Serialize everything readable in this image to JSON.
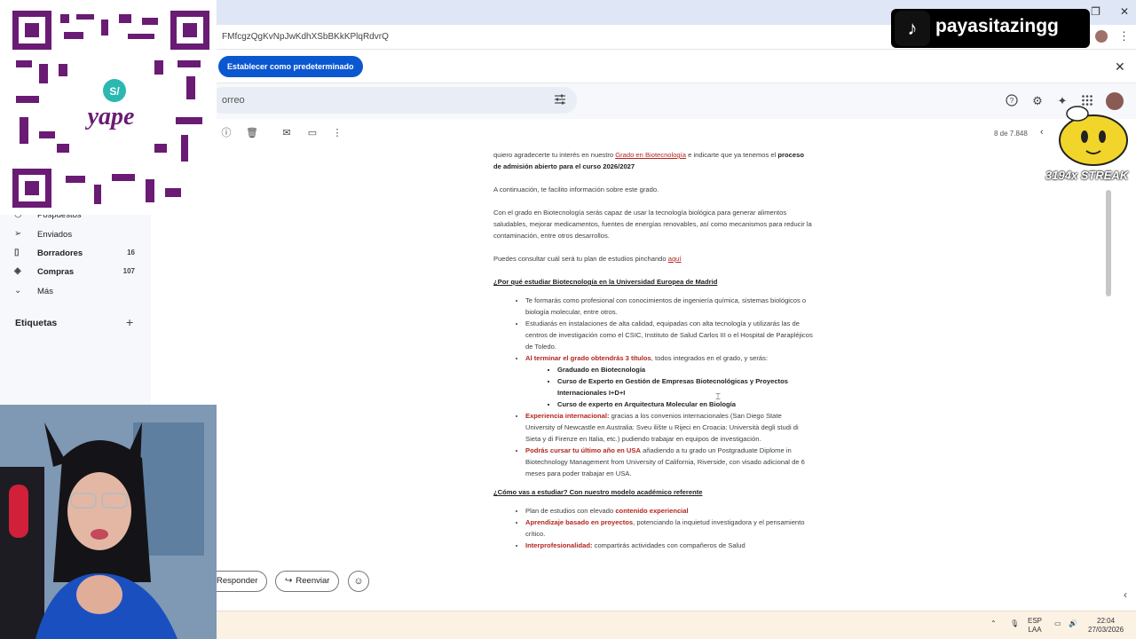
{
  "browser": {
    "url_fragment": "FMfcgzQgKvNpJwKdhXSbBKkKPlqRdvrQ",
    "set_default_button": "Establecer como predeterminado",
    "close_label": "✕",
    "menu_label": "⋮"
  },
  "gmail": {
    "search_placeholder": "orreo",
    "toolbar": {
      "pager": "8 de 7.848",
      "prev_label": "‹"
    },
    "sidebar": {
      "items": [
        {
          "label": "Pospuestos",
          "count": ""
        },
        {
          "label": "Enviados",
          "count": ""
        },
        {
          "label": "Borradores",
          "count": "16"
        },
        {
          "label": "Compras",
          "count": "107"
        },
        {
          "label": "Más",
          "count": ""
        }
      ],
      "labels_heading": "Etiquetas",
      "labels_add": "+"
    },
    "email": {
      "p1_a": "quiero agradecerte tu interés en nuestro ",
      "p1_link": "Grado en Biotecnología",
      "p1_b": " e indicarte que ya tenemos el ",
      "p1_bold": "proceso de admisión abierto para el curso 2026/2027",
      "p2": "A continuación, te facilito información sobre este grado.",
      "p3": "Con el grado en Biotecnología serás capaz de usar la tecnología biológica para generar alimentos saludables, mejorar medicamentos, fuentes de energías renovables, así como mecanismos para reducir la contaminación, entre otros desarrollos.",
      "p4_a": "Puedes consultar cuál será tu plan de estudios pinchando ",
      "p4_link": "aquí",
      "h1": "¿Por qué estudiar Biotecnología en la Universidad Europea de Madrid",
      "b1": "Te formarás como profesional con conocimientos de ingeniería química, sistemas biológicos o biología molecular, entre otros.",
      "b2": "Estudiarás en instalaciones de alta calidad, equipadas con alta tecnología y utilizarás las de centros de investigación como el CSIC, Instituto de Salud Carlos III o el Hospital de Parapléjicos de Toledo.",
      "b3_red": "Al terminar el grado obtendrás 3 títulos",
      "b3_rest": ", todos integrados en el grado, y serás:",
      "sub1": "Graduado en Biotecnología",
      "sub2": "Curso de Experto en Gestión de Empresas Biotecnológicas y Proyectos Internacionales I+D+I",
      "sub3": "Curso de experto en Arquitectura Molecular en Biología",
      "b4_red": "Experiencia internacional:",
      "b4_rest": " gracias a los convenios internacionales (San Diego State University of Newcastle en Australia: Sveu ilište u Rijeci en Croacia: Università degli studi di Sieta y di Firenze en Italia, etc.) pudiendo trabajar en equipos de investigación.",
      "b5_red": "Podrás cursar tu último año en USA",
      "b5_rest": " añadiendo a tu grado un Postgraduate Diplome in Biotechnology Management from University of California, Riverside, con visado adicional de 6 meses para poder trabajar en USA.",
      "h2": "¿Cómo vas a estudiar? Con nuestro modelo académico referente",
      "c1_a": "Plan de estudios con elevado ",
      "c1_red": "contenido experiencial",
      "c2_red": "Aprendizaje basado en proyectos",
      "c2_rest": ", potenciando la inquietud investigadora y el pensamiento crítico.",
      "c3_red": "Interprofesionalidad:",
      "c3_rest": " compartirás actividades con compañeros de Salud"
    },
    "reply": {
      "reply_label": "Responder",
      "forward_label": "Reenviar"
    }
  },
  "overlays": {
    "tiktok_name": "payasitazingg",
    "streak": "3194x STREAK",
    "qr_brand": "yape"
  },
  "taskbar": {
    "lang_top": "ESP",
    "lang_bottom": "LAA",
    "time": "22:04",
    "date": "27/03/2026"
  },
  "colors": {
    "accent": "#0b57d0",
    "link_red": "#b3261e",
    "qr_purple": "#6a1b73",
    "taskbar": "#fbf2e4"
  }
}
